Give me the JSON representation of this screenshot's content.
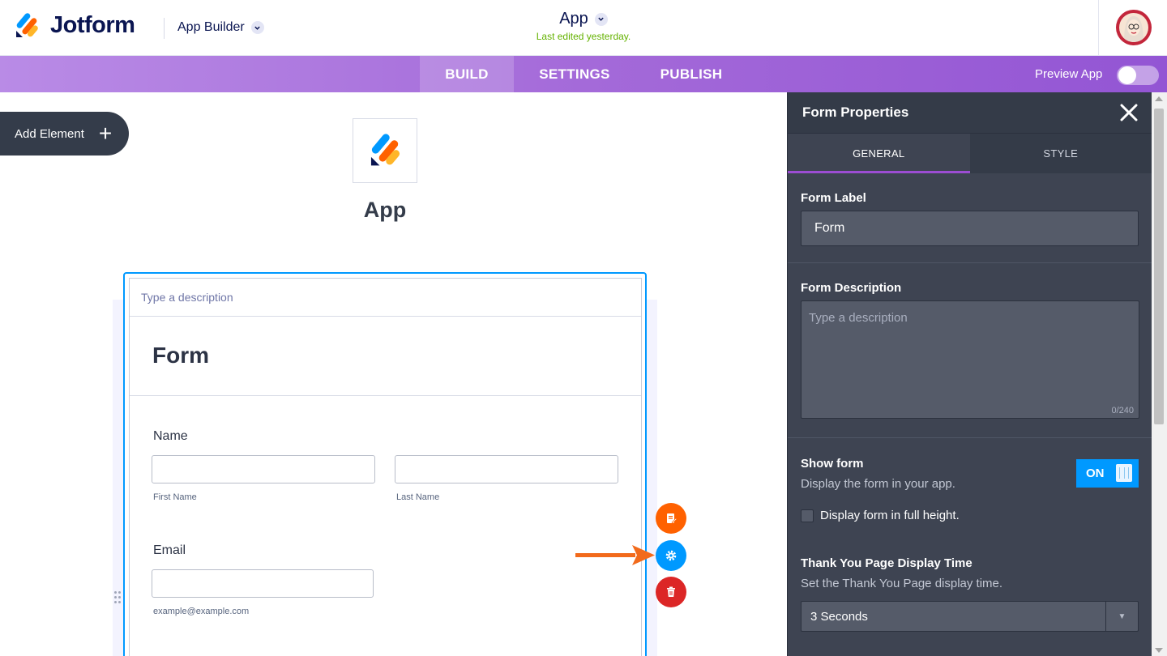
{
  "header": {
    "brand": "Jotform",
    "product": "App Builder",
    "app_title": "App",
    "last_edited": "Last edited yesterday."
  },
  "nav": {
    "tabs": [
      {
        "label": "BUILD",
        "active": true
      },
      {
        "label": "SETTINGS",
        "active": false
      },
      {
        "label": "PUBLISH",
        "active": false
      }
    ],
    "preview_label": "Preview App"
  },
  "canvas": {
    "add_element": "Add Element",
    "app_name": "App",
    "form": {
      "description_placeholder": "Type a description",
      "title": "Form",
      "name_label": "Name",
      "first_name_sub": "First Name",
      "last_name_sub": "Last Name",
      "email_label": "Email",
      "email_sub": "example@example.com"
    }
  },
  "panel": {
    "title": "Form Properties",
    "tabs": [
      {
        "label": "GENERAL",
        "active": true
      },
      {
        "label": "STYLE",
        "active": false
      }
    ],
    "form_label": {
      "label": "Form Label",
      "value": "Form"
    },
    "form_description": {
      "label": "Form Description",
      "placeholder": "Type a description",
      "count": "0/240"
    },
    "show_form": {
      "label": "Show form",
      "help": "Display the form in your app.",
      "toggle": "ON",
      "checkbox_label": "Display form in full height."
    },
    "thank_you": {
      "label": "Thank You Page Display Time",
      "help": "Set the Thank You Page display time.",
      "value": "3 Seconds"
    }
  },
  "colors": {
    "accent_blue": "#0099ff",
    "brand_purple": "#9c4dd3",
    "edit_orange": "#ff6100",
    "delete_red": "#dc2626",
    "edited_green": "#64b200"
  }
}
